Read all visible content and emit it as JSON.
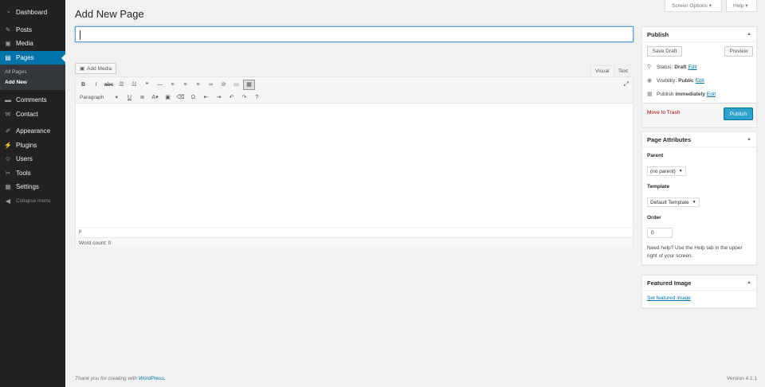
{
  "sidebar": {
    "items": [
      {
        "label": "Dashboard",
        "icon": "dashboard-icon"
      },
      {
        "label": "Posts",
        "icon": "pin-icon"
      },
      {
        "label": "Media",
        "icon": "media-icon"
      },
      {
        "label": "Pages",
        "icon": "page-icon",
        "active": true
      },
      {
        "label": "Comments",
        "icon": "comment-icon"
      },
      {
        "label": "Contact",
        "icon": "mail-icon"
      },
      {
        "label": "Appearance",
        "icon": "brush-icon"
      },
      {
        "label": "Plugins",
        "icon": "plugin-icon"
      },
      {
        "label": "Users",
        "icon": "users-icon"
      },
      {
        "label": "Tools",
        "icon": "wrench-icon"
      },
      {
        "label": "Settings",
        "icon": "settings-icon"
      }
    ],
    "submenu": {
      "all_pages": "All Pages",
      "add_new": "Add New"
    },
    "collapse": "Collapse menu"
  },
  "top": {
    "screen_options": "Screen Options",
    "help": "Help"
  },
  "page_title": "Add New Page",
  "editor": {
    "add_media": "Add Media",
    "tab_visual": "Visual",
    "tab_text": "Text",
    "format_select": "Paragraph",
    "path": "p",
    "word_count": "Word count: 0"
  },
  "publish": {
    "title": "Publish",
    "save_draft": "Save Draft",
    "preview": "Preview",
    "status_label": "Status:",
    "status_value": "Draft",
    "visibility_label": "Visibility:",
    "visibility_value": "Public",
    "publish_label": "Publish",
    "publish_value": "immediately",
    "edit": "Edit",
    "trash": "Move to Trash",
    "publish_button": "Publish"
  },
  "page_attributes": {
    "title": "Page Attributes",
    "parent_label": "Parent",
    "parent_value": "(no parent)",
    "template_label": "Template",
    "template_value": "Default Template",
    "order_label": "Order",
    "order_value": "0",
    "help": "Need help? Use the Help tab in the upper right of your screen."
  },
  "featured_image": {
    "title": "Featured Image",
    "link": "Set featured image"
  },
  "footer": {
    "thanks": "Thank you for creating with",
    "wp": "WordPress.",
    "version": "Version 4.1.1"
  },
  "colors": {
    "accent": "#0073aa",
    "sidebar": "#222222",
    "primary_button": "#2ea2cc",
    "trash": "#aa0000"
  }
}
